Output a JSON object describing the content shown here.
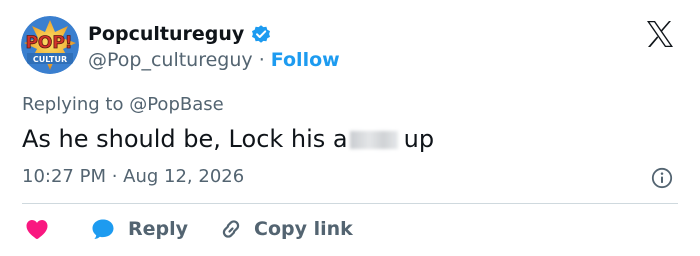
{
  "author": {
    "display_name": "Popcultureguy",
    "handle": "@Pop_cultureguy",
    "separator": "·",
    "follow_label": "Follow",
    "avatar_text_top": "POP!",
    "avatar_text_band": "CULTUR",
    "verified": true
  },
  "tweet": {
    "reply_prefix": "Replying to",
    "reply_handle": "@PopBase",
    "text_before": "As he should be, Lock his a",
    "text_after": "up",
    "timestamp": "10:27 PM · Aug 12, 2026"
  },
  "actions": {
    "reply_label": "Reply",
    "copy_link_label": "Copy link"
  },
  "colors": {
    "brand_blue": "#1d9bf0",
    "like_red": "#f91880",
    "text_primary": "#0f1419",
    "text_secondary": "#536471",
    "divider": "#cfd9de"
  },
  "icons": [
    "verified-badge-icon",
    "x-logo-icon",
    "info-icon",
    "heart-icon",
    "reply-bubble-icon",
    "link-icon"
  ]
}
